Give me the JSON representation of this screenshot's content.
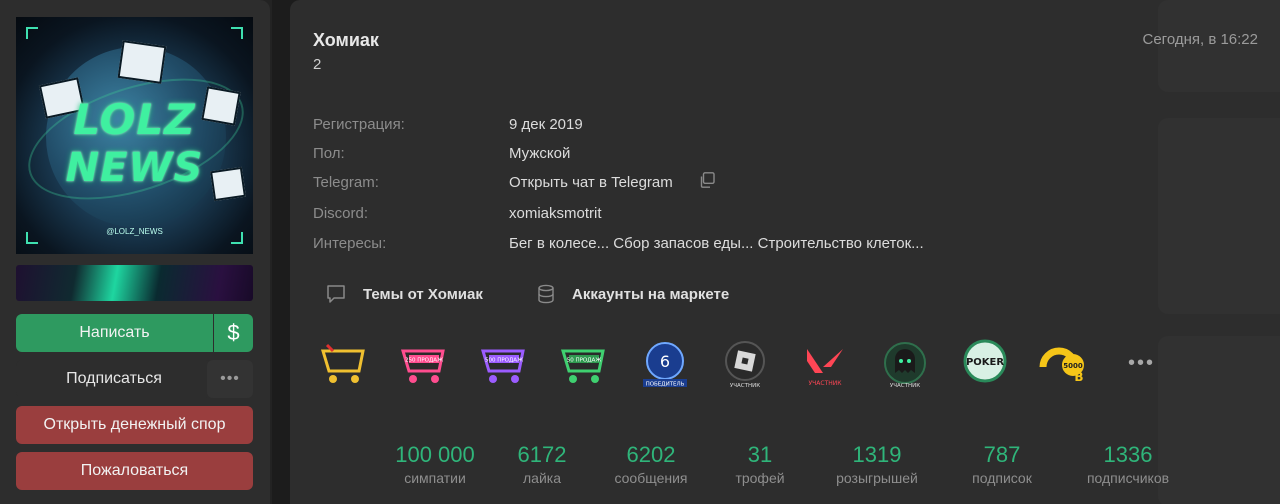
{
  "profile": {
    "name": "Хомиак",
    "subtitle": "2",
    "last_seen": "Сегодня, в 16:22",
    "avatar_text": {
      "line1": "LOLZ",
      "line2": "NEWS",
      "tag": "@LOLZ_NEWS"
    }
  },
  "info": [
    {
      "label": "Регистрация:",
      "value": "9 дек 2019"
    },
    {
      "label": "Пол:",
      "value": "Мужской"
    },
    {
      "label": "Telegram:",
      "value": "Открыть чат в Telegram"
    },
    {
      "label": "Discord:",
      "value": "xomiaksmotrit"
    },
    {
      "label": "Интересы:",
      "value": "Бег в колесе... Сбор запасов еды... Строительство клеток..."
    }
  ],
  "links": {
    "topics": "Темы от Хомиак",
    "market": "Аккаунты на маркете"
  },
  "actions": {
    "write": "Написать",
    "currency": "$",
    "subscribe": "Подписаться",
    "more": "•••",
    "dispute": "Открыть денежный спор",
    "report": "Пожаловаться"
  },
  "trophies": [
    {
      "icon": "cart-trophy-yellow-icon",
      "caption": ""
    },
    {
      "icon": "cart-trophy-pink-icon",
      "caption": "250 ПРОДАЖ"
    },
    {
      "icon": "cart-trophy-purple-icon",
      "caption": "500 ПРОДАЖ"
    },
    {
      "icon": "cart-trophy-green-icon",
      "caption": "50 ПРОДАЖ"
    },
    {
      "icon": "rainbow-six-trophy-icon",
      "caption": "ПОБЕДИТЕЛЬ"
    },
    {
      "icon": "roblox-trophy-icon",
      "caption": "УЧАСТНИК"
    },
    {
      "icon": "valorant-trophy-icon",
      "caption": "УЧАСТНИК"
    },
    {
      "icon": "ghost-trophy-icon",
      "caption": "УЧАСТНИК"
    },
    {
      "icon": "poker-trophy-icon",
      "caption": "POKER"
    },
    {
      "icon": "5000-trophy-icon",
      "caption": "5000"
    }
  ],
  "trophies_more": "•••",
  "stats": [
    {
      "value": "100 000",
      "label": "симпатии"
    },
    {
      "value": "6172",
      "label": "лайка"
    },
    {
      "value": "6202",
      "label": "сообщения"
    },
    {
      "value": "31",
      "label": "трофей"
    },
    {
      "value": "1319",
      "label": "розыгрышей"
    },
    {
      "value": "787",
      "label": "подписок"
    },
    {
      "value": "1336",
      "label": "подписчиков"
    }
  ],
  "colors": {
    "accent_green": "#2e9a60",
    "stat_green": "#2fb57a",
    "danger_red": "#9a3e3e",
    "panel": "#2d2d2d",
    "background": "#1c1c1c"
  }
}
